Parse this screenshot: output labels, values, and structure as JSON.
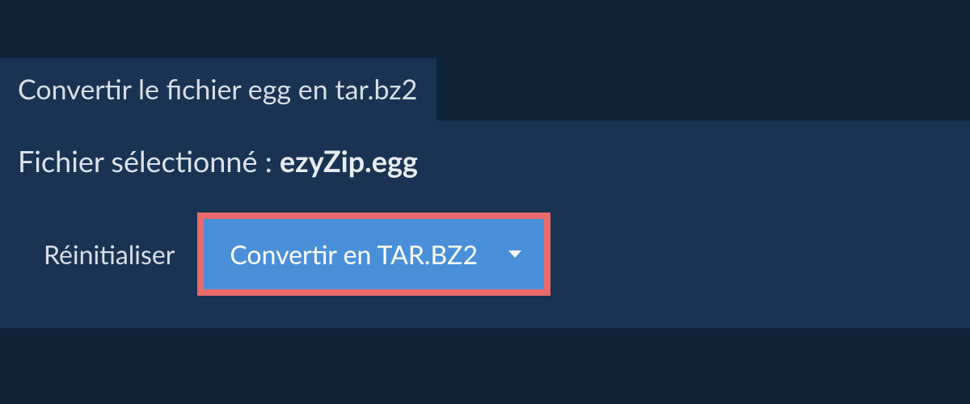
{
  "tab": {
    "label": "Convertir le fichier egg en tar.bz2"
  },
  "selectedFile": {
    "prefix": "Fichier sélectionné : ",
    "filename": "ezyZip.egg"
  },
  "buttons": {
    "reset": "Réinitialiser",
    "convert": "Convertir en TAR.BZ2"
  }
}
